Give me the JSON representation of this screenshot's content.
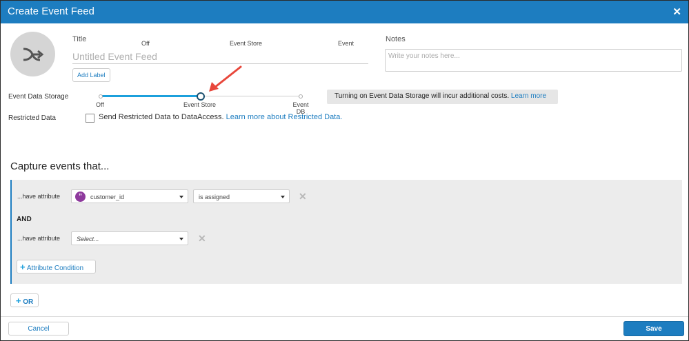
{
  "dialog": {
    "title": "Create Event Feed",
    "close_icon": "close-icon",
    "close_glyph": "✕"
  },
  "form": {
    "title_label": "Title",
    "title_value": "",
    "title_placeholder": "Untitled Event Feed",
    "add_label_button": "Add Label",
    "notes_label": "Notes",
    "notes_placeholder": "Write your notes here..."
  },
  "storage": {
    "label": "Event Data Storage",
    "top_labels": [
      "Off",
      "Event Store",
      "Event"
    ],
    "options": [
      "Off",
      "Event Store",
      "Event DB"
    ],
    "selected": "Event Store",
    "selected_index": 1,
    "banner_text": "Turning on Event Data Storage will incur additional costs.",
    "banner_link": "Learn more"
  },
  "restricted": {
    "label": "Restricted Data",
    "checked": false,
    "text": "Send Restricted Data to DataAccess.",
    "link": "Learn more about Restricted Data."
  },
  "capture": {
    "heading": "Capture events that...",
    "conditions": [
      {
        "label": "...have attribute",
        "attribute": "customer_id",
        "attribute_icon_glyph": "”",
        "operator": "is assigned"
      },
      {
        "label": "...have attribute",
        "attribute": "Select...",
        "operator": null
      }
    ],
    "and_label": "AND",
    "add_condition_button": "Attribute Condition",
    "or_button": "OR",
    "plus_glyph": "+",
    "remove_glyph": "✕"
  },
  "footer": {
    "cancel": "Cancel",
    "save": "Save"
  },
  "colors": {
    "accent": "#1d7dc0",
    "slider_fill": "#1ca0dc",
    "attribute_icon": "#8e3a9d",
    "annotation_arrow": "#e8473b"
  }
}
